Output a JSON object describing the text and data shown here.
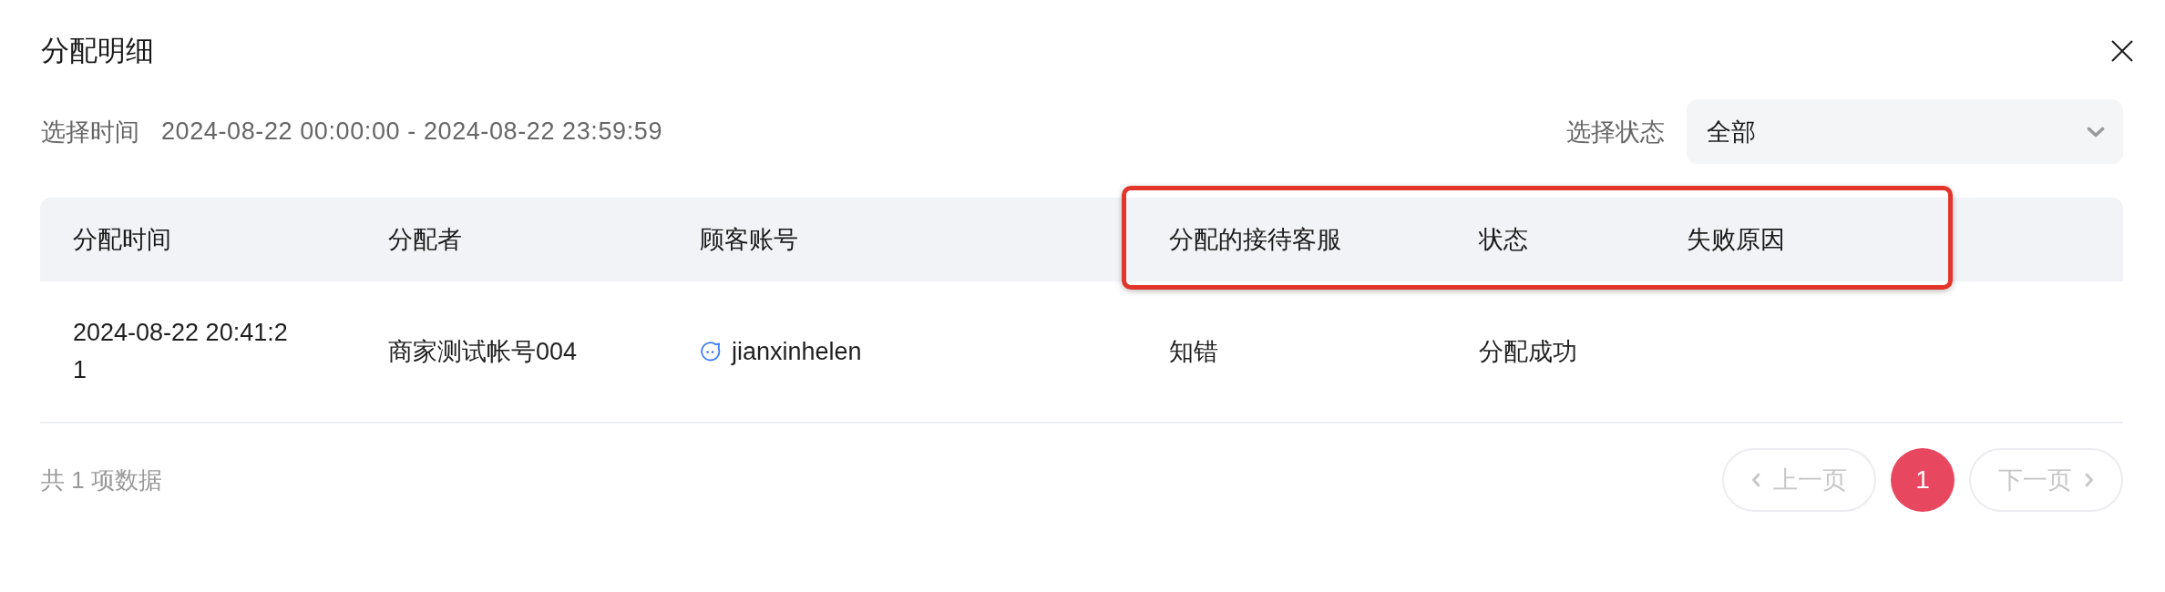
{
  "dialog": {
    "title": "分配明细"
  },
  "filters": {
    "time_label": "选择时间",
    "time_range": "2024-08-22 00:00:00 - 2024-08-22 23:59:59",
    "status_label": "选择状态",
    "status_value": "全部"
  },
  "table": {
    "column_groups": [
      {
        "highlighted": false,
        "columns": [
          "分配时间",
          "分配者",
          "顾客账号"
        ]
      },
      {
        "highlighted": true,
        "columns": [
          "分配的接待客服",
          "状态",
          "失败原因"
        ]
      }
    ],
    "rows": [
      {
        "cells": [
          {
            "kind": "time",
            "text": "2024-08-22 20:41:21"
          },
          {
            "kind": "text",
            "text": "商家测试帐号004"
          },
          {
            "kind": "customer",
            "text": "jianxinhelen"
          },
          {
            "kind": "text",
            "text": "知错"
          },
          {
            "kind": "text",
            "text": "分配成功"
          }
        ]
      }
    ]
  },
  "pagination": {
    "summary": "共 1 项数据",
    "prev": {
      "label": "上一页",
      "disabled": true
    },
    "pages": [
      {
        "label": "1",
        "selected": true
      }
    ],
    "next": {
      "label": "下一页",
      "disabled": true
    }
  }
}
